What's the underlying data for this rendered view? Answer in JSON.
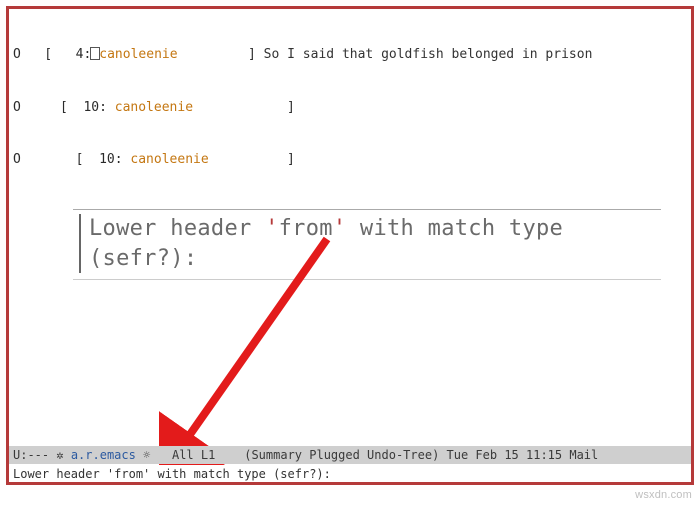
{
  "threads": [
    {
      "prefix": "O   [   4:",
      "author": "canoleenie",
      "pad": "         ",
      "close": "] ",
      "subject": "So I said that goldfish belonged in prison",
      "has_cursor": true
    },
    {
      "prefix": "O     [  10: ",
      "author": "canoleenie",
      "pad": "            ",
      "close": "]",
      "subject": "",
      "has_cursor": false
    },
    {
      "prefix": "O       [  10: ",
      "author": "canoleenie",
      "pad": "          ",
      "close": "]",
      "subject": "",
      "has_cursor": false
    }
  ],
  "callout": {
    "text_plain": "Lower header 'from' with match type (sefr?):",
    "pre": "Lower header ",
    "q1": "'",
    "mid": "from",
    "q2": "'",
    "post": " with match type (sefr?):"
  },
  "modeline": {
    "left": "U:--- ",
    "icon": "✲",
    "bufname": " a.r.emacs ",
    "marker": "☼",
    "mid": "   All L1    ",
    "right": "(Summary Plugged Undo-Tree) Tue Feb 15 11:15 Mail"
  },
  "minibuffer": {
    "prompt": "Lower header 'from' with match type (sefr?): "
  },
  "watermark": "wsxdn.com"
}
